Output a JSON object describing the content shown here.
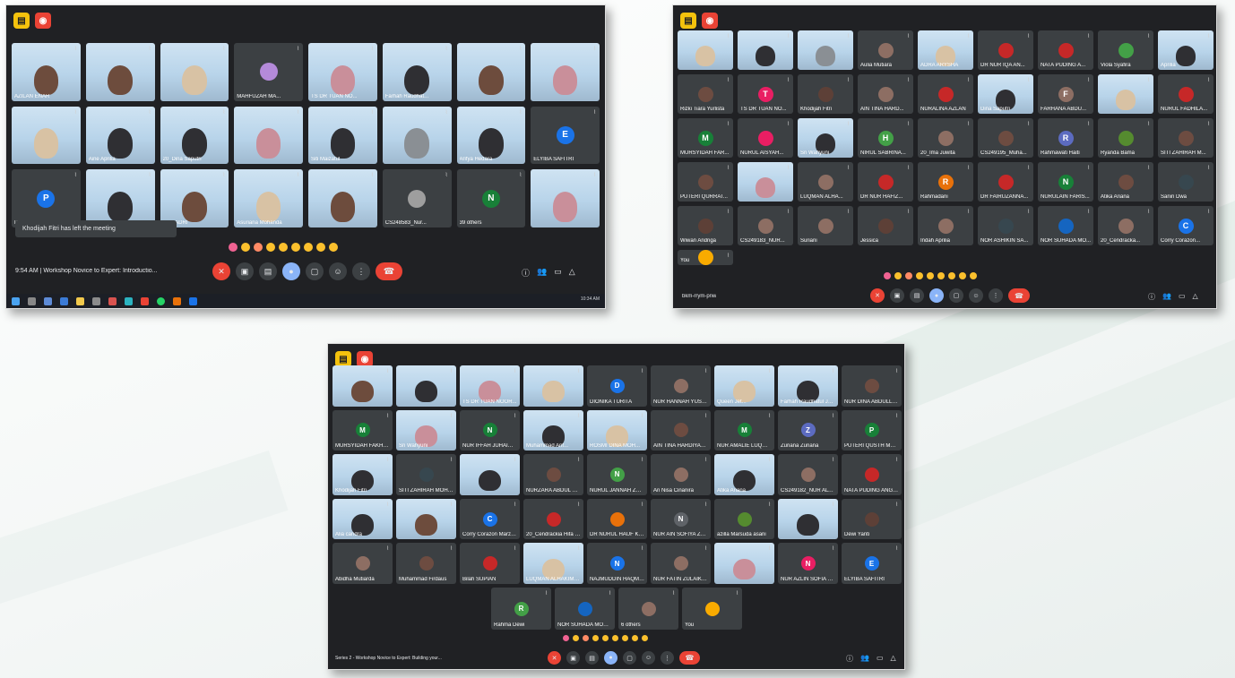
{
  "colors": {
    "meet_bg": "#202124",
    "tile_bg": "#3c4043",
    "red": "#ea4335",
    "blue": "#8ab4f8",
    "yellow": "#f4c20d"
  },
  "screenshot1": {
    "tiles": [
      {
        "name": "AZILAN ENAR",
        "type": "video",
        "face": "brown"
      },
      {
        "name": "",
        "type": "video",
        "face": "brown"
      },
      {
        "name": "",
        "type": "video",
        "face": "beige"
      },
      {
        "name": "MAHFUZAH MA...",
        "type": "avatar",
        "initial": "",
        "color": "#b48ad9"
      },
      {
        "name": "TS DR TUAN NO...",
        "type": "video",
        "face": "pink"
      },
      {
        "name": "Farhah Raudhat...",
        "type": "video",
        "face": "hij"
      },
      {
        "name": "",
        "type": "video",
        "face": "brown"
      },
      {
        "name": "",
        "type": "video",
        "face": "pink"
      },
      {
        "name": "",
        "type": "video",
        "face": "beige"
      },
      {
        "name": "Aine Aprilia",
        "type": "video",
        "face": "hij"
      },
      {
        "name": "20_Dina Saputri",
        "type": "video",
        "face": "hij"
      },
      {
        "name": "",
        "type": "video",
        "face": "pink"
      },
      {
        "name": "Siti Maizatul",
        "type": "video",
        "face": "hij"
      },
      {
        "name": "",
        "type": "video",
        "face": "gray"
      },
      {
        "name": "Arifya Hedara",
        "type": "video",
        "face": "hij"
      },
      {
        "name": "ELYIBA SAFITRI",
        "type": "avatar",
        "initial": "E",
        "color": "#1a73e8"
      },
      {
        "name": "PUTERI QURRAT...",
        "type": "avatar",
        "initial": "P",
        "color": "#1a73e8"
      },
      {
        "name": "Thessa Rahma",
        "type": "video",
        "face": "hij"
      },
      {
        "name": "...A FADRI",
        "type": "video",
        "face": "brown"
      },
      {
        "name": "Asuriana Mohanda",
        "type": "video",
        "face": "beige"
      },
      {
        "name": "",
        "type": "video",
        "face": "brown"
      },
      {
        "name": "CS248583_Nur...",
        "type": "avatar",
        "initial": "",
        "color": "#9e9e9e"
      },
      {
        "name": "39 others",
        "type": "avatar",
        "initial": "N",
        "color": "#188038"
      },
      {
        "name": "",
        "type": "video",
        "face": "pink"
      }
    ],
    "toast": "Khodijah Fitri has left the meeting",
    "meeting_info": "9:54 AM  |  Workshop Novice to Expert: Introductio...",
    "taskbar_time": "10:34 AM"
  },
  "screenshot2": {
    "tiles": [
      {
        "name": "",
        "type": "video",
        "face": "beige"
      },
      {
        "name": "",
        "type": "video",
        "face": "hij"
      },
      {
        "name": "",
        "type": "video",
        "face": "gray"
      },
      {
        "name": "Aulia Mutiara",
        "type": "avatar",
        "initial": "",
        "color": "#8d6e63"
      },
      {
        "name": "ADRA ARYSHA",
        "type": "video",
        "face": "beige"
      },
      {
        "name": "DR NUR IQA AN...",
        "type": "avatar",
        "initial": "",
        "color": "#c62828"
      },
      {
        "name": "NATA PUDING A...",
        "type": "avatar",
        "initial": "",
        "color": "#c62828"
      },
      {
        "name": "Viola Syafira",
        "type": "avatar",
        "initial": "",
        "color": "#43a047"
      },
      {
        "name": "Aprilia",
        "type": "video",
        "face": "hij"
      },
      {
        "name": "Rizki Tiara Yurlista",
        "type": "avatar",
        "initial": "",
        "color": "#6d4c41"
      },
      {
        "name": "TS DR TUAN NO...",
        "type": "avatar",
        "initial": "T",
        "color": "#e91e63"
      },
      {
        "name": "Khodijah Fitri",
        "type": "avatar",
        "initial": "",
        "color": "#5d4037"
      },
      {
        "name": "AIN TINA HARD...",
        "type": "avatar",
        "initial": "",
        "color": "#8d6e63"
      },
      {
        "name": "NURALINA AZLAN",
        "type": "avatar",
        "initial": "",
        "color": "#c62828"
      },
      {
        "name": "Dina Saputri",
        "type": "video",
        "face": "hij"
      },
      {
        "name": "FARHANA ABDU...",
        "type": "avatar",
        "initial": "F",
        "color": "#8d6e63"
      },
      {
        "name": "",
        "type": "video",
        "face": "beige"
      },
      {
        "name": "NURUL FADHILA...",
        "type": "avatar",
        "initial": "",
        "color": "#c62828"
      },
      {
        "name": "MURSYIDAH FAR...",
        "type": "avatar",
        "initial": "M",
        "color": "#188038"
      },
      {
        "name": "NURUL AISYAH...",
        "type": "avatar",
        "initial": "",
        "color": "#e91e63"
      },
      {
        "name": "Sri Wahyuni",
        "type": "video",
        "face": "hij"
      },
      {
        "name": "NIRUL SABRINA...",
        "type": "avatar",
        "initial": "H",
        "color": "#43a047"
      },
      {
        "name": "20_Ima Juwita",
        "type": "avatar",
        "initial": "",
        "color": "#8d6e63"
      },
      {
        "name": "CS249195_Muha...",
        "type": "avatar",
        "initial": "",
        "color": "#6d4c41"
      },
      {
        "name": "Rahmawati Haiti",
        "type": "avatar",
        "initial": "R",
        "color": "#5c6bc0"
      },
      {
        "name": "Ryanda Bama",
        "type": "avatar",
        "initial": "",
        "color": "#558b2f"
      },
      {
        "name": "SITI ZAHIRAH M...",
        "type": "avatar",
        "initial": "",
        "color": "#6d4c41"
      },
      {
        "name": "PUTERI QURRAT...",
        "type": "avatar",
        "initial": "",
        "color": "#6d4c41"
      },
      {
        "name": "",
        "type": "video",
        "face": "pink"
      },
      {
        "name": "LUQMAN ALHA...",
        "type": "avatar",
        "initial": "",
        "color": "#8d6e63"
      },
      {
        "name": "DR NUR HAFIZ...",
        "type": "avatar",
        "initial": "",
        "color": "#c62828"
      },
      {
        "name": "Rahmadani",
        "type": "avatar",
        "initial": "R",
        "color": "#e8710a"
      },
      {
        "name": "DR FAIRUZANNA...",
        "type": "avatar",
        "initial": "",
        "color": "#c62828"
      },
      {
        "name": "NURULAIN FARIS...",
        "type": "avatar",
        "initial": "N",
        "color": "#188038"
      },
      {
        "name": "Atika Ariana",
        "type": "avatar",
        "initial": "",
        "color": "#6d4c41"
      },
      {
        "name": "Saniri Dwa",
        "type": "avatar",
        "initial": "",
        "color": "#37474f"
      },
      {
        "name": "Wiwan Andriga",
        "type": "avatar",
        "initial": "",
        "color": "#5d4037"
      },
      {
        "name": "CS249183_NUR...",
        "type": "avatar",
        "initial": "",
        "color": "#8d6e63"
      },
      {
        "name": "Suriani",
        "type": "avatar",
        "initial": "",
        "color": "#8d6e63"
      },
      {
        "name": "Jessica",
        "type": "avatar",
        "initial": "",
        "color": "#5d4037"
      },
      {
        "name": "Indah Aprilia",
        "type": "avatar",
        "initial": "",
        "color": "#8d6e63"
      },
      {
        "name": "NOR ASHIKIN SA...",
        "type": "avatar",
        "initial": "",
        "color": "#37474f"
      },
      {
        "name": "NOR SUHADA MO...",
        "type": "avatar",
        "initial": "",
        "color": "#1565c0"
      },
      {
        "name": "20_Cendracka...",
        "type": "avatar",
        "initial": "",
        "color": "#8d6e63"
      },
      {
        "name": "Corry Corazon...",
        "type": "avatar",
        "initial": "C",
        "color": "#1a73e8"
      },
      {
        "name": "You",
        "type": "avatar",
        "initial": "",
        "color": "#f9ab00"
      }
    ],
    "meeting_info": "bkm-rrym-pnw"
  },
  "screenshot3": {
    "tiles": [
      {
        "name": "",
        "type": "video",
        "face": "brown"
      },
      {
        "name": "",
        "type": "video",
        "face": "hij"
      },
      {
        "name": "TS DR TUAN NOOR...",
        "type": "video",
        "face": "pink"
      },
      {
        "name": "",
        "type": "video",
        "face": "beige"
      },
      {
        "name": "DIONIKA TURITA",
        "type": "avatar",
        "initial": "D",
        "color": "#1a73e8"
      },
      {
        "name": "NUR HANNAH YUSM...",
        "type": "avatar",
        "initial": "",
        "color": "#8d6e63"
      },
      {
        "name": "Queen Jet...",
        "type": "video",
        "face": "beige"
      },
      {
        "name": "Farhah Raudhatul Jan...",
        "type": "video",
        "face": "hij"
      },
      {
        "name": "NUR DINA ABDULLAH",
        "type": "avatar",
        "initial": "",
        "color": "#6d4c41"
      },
      {
        "name": "MURSYIDAH FAKHAR...",
        "type": "avatar",
        "initial": "M",
        "color": "#188038"
      },
      {
        "name": "Sri Wahyuni",
        "type": "video",
        "face": "pink"
      },
      {
        "name": "NUR IFFAH JUHAIDI...",
        "type": "avatar",
        "initial": "N",
        "color": "#188038"
      },
      {
        "name": "Muhammad Arif...",
        "type": "video",
        "face": "hij"
      },
      {
        "name": "ROSMI DINA MOH...",
        "type": "video",
        "face": "beige"
      },
      {
        "name": "AIN TINA HARDIYANTI",
        "type": "avatar",
        "initial": "",
        "color": "#6d4c41"
      },
      {
        "name": "NUR AMALIE LUQMA...",
        "type": "avatar",
        "initial": "M",
        "color": "#188038"
      },
      {
        "name": "Zuriana Zuriana",
        "type": "avatar",
        "initial": "Z",
        "color": "#5c6bc0"
      },
      {
        "name": "PUTERI QUSTH MERA...",
        "type": "avatar",
        "initial": "P",
        "color": "#188038"
      },
      {
        "name": "Khodijah Fitri",
        "type": "video",
        "face": "hij"
      },
      {
        "name": "SITI ZAHIRAH MOHD...",
        "type": "avatar",
        "initial": "",
        "color": "#37474f"
      },
      {
        "name": "",
        "type": "video",
        "face": "hij"
      },
      {
        "name": "NURZARA ABDUL HA...",
        "type": "avatar",
        "initial": "",
        "color": "#6d4c41"
      },
      {
        "name": "NURUL JANNAH ZAM...",
        "type": "avatar",
        "initial": "N",
        "color": "#43a047"
      },
      {
        "name": "An Nisa Cinanira",
        "type": "avatar",
        "initial": "",
        "color": "#8d6e63"
      },
      {
        "name": "Atika Ariana",
        "type": "video",
        "face": "hij"
      },
      {
        "name": "CS249182_NUR ALY...",
        "type": "avatar",
        "initial": "",
        "color": "#8d6e63"
      },
      {
        "name": "NATA PUDING ANGG...",
        "type": "avatar",
        "initial": "",
        "color": "#c62828"
      },
      {
        "name": "Alia candra",
        "type": "video",
        "face": "hij"
      },
      {
        "name": "",
        "type": "video",
        "face": "brown"
      },
      {
        "name": "Corry Corazon Marzuki",
        "type": "avatar",
        "initial": "C",
        "color": "#1a73e8"
      },
      {
        "name": "20_Cendrackia Hifa S...",
        "type": "avatar",
        "initial": "",
        "color": "#c62828"
      },
      {
        "name": "DR NURUL HAUF KHA...",
        "type": "avatar",
        "initial": "",
        "color": "#e8710a"
      },
      {
        "name": "NUR AIN SOFIYA ZAIN...",
        "type": "avatar",
        "initial": "N",
        "color": "#5f6368"
      },
      {
        "name": "azilla Marsuda asani",
        "type": "avatar",
        "initial": "",
        "color": "#558b2f"
      },
      {
        "name": "",
        "type": "video",
        "face": "hij"
      },
      {
        "name": "Dewi Yanti",
        "type": "avatar",
        "initial": "",
        "color": "#5d4037"
      },
      {
        "name": "Abidha Mutiarda",
        "type": "avatar",
        "initial": "",
        "color": "#8d6e63"
      },
      {
        "name": "Muhammad Firdaus",
        "type": "avatar",
        "initial": "",
        "color": "#6d4c41"
      },
      {
        "name": "Bilah SUPIAN",
        "type": "avatar",
        "initial": "",
        "color": "#c62828"
      },
      {
        "name": "LUQMAN ALHAKIM M...",
        "type": "video",
        "face": "beige"
      },
      {
        "name": "NAJMUDDIN HAQMI...",
        "type": "avatar",
        "initial": "N",
        "color": "#1a73e8"
      },
      {
        "name": "NUR FATIN ZULAIKHA...",
        "type": "avatar",
        "initial": "",
        "color": "#8d6e63"
      },
      {
        "name": "",
        "type": "video",
        "face": "pink"
      },
      {
        "name": "NUR AZLIN SOFIA R...",
        "type": "avatar",
        "initial": "N",
        "color": "#e91e63"
      },
      {
        "name": "ELYIBA SAFITRI",
        "type": "avatar",
        "initial": "E",
        "color": "#1a73e8"
      },
      {
        "name": "Rahma Dewi",
        "type": "avatar",
        "initial": "R",
        "color": "#43a047"
      },
      {
        "name": "NOR SUHADA MOHD...",
        "type": "avatar",
        "initial": "",
        "color": "#1565c0"
      },
      {
        "name": "6 others",
        "type": "avatar",
        "initial": "",
        "color": "#8d6e63"
      },
      {
        "name": "You",
        "type": "avatar",
        "initial": "",
        "color": "#f9ab00"
      }
    ],
    "meeting_info": "Series 2 - Workshop Novice to Expert: Building your..."
  }
}
